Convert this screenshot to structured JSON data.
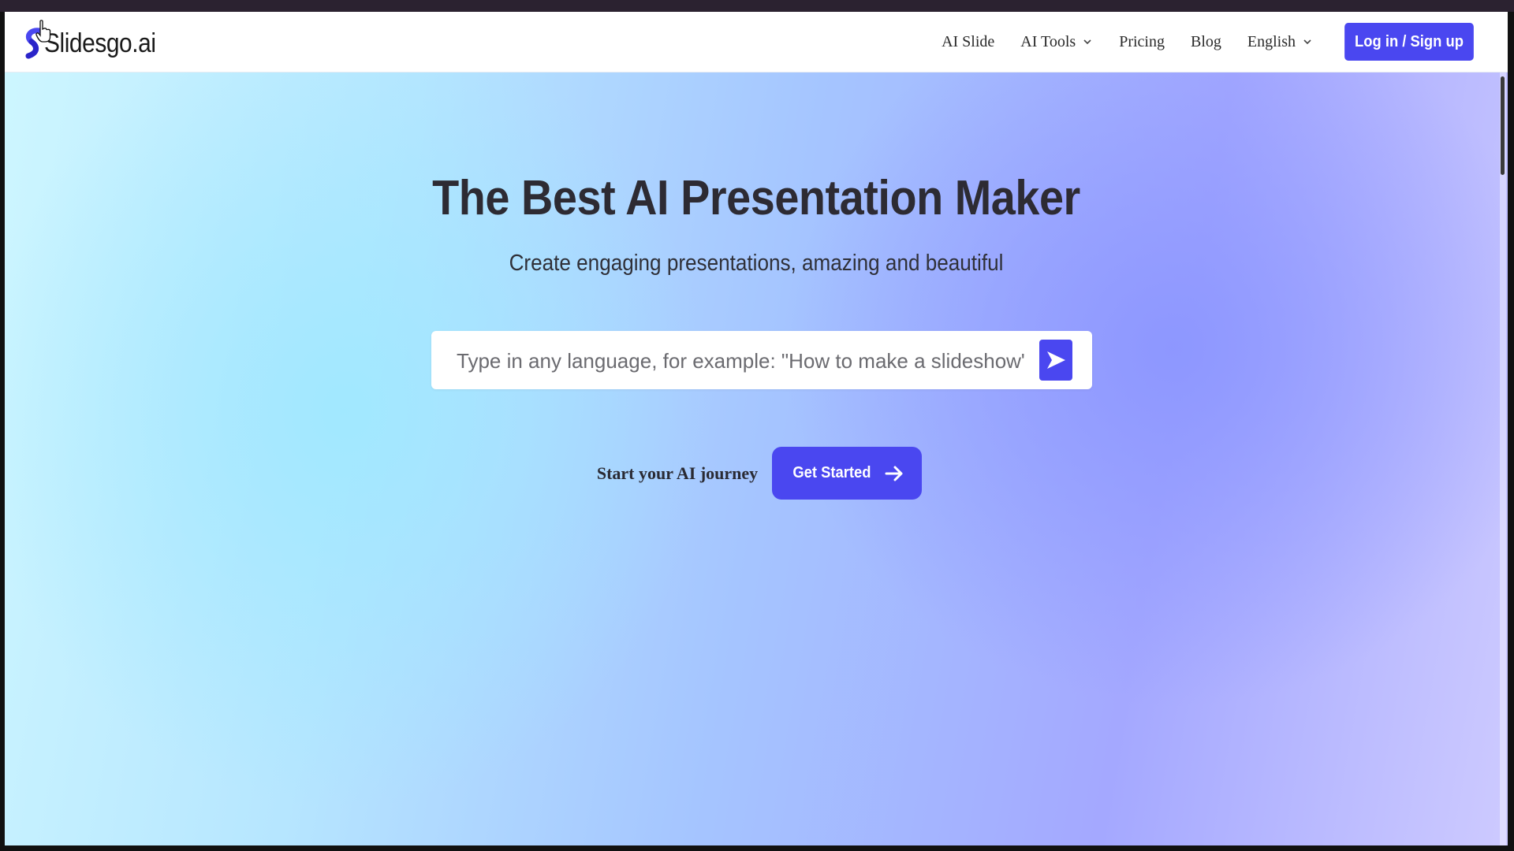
{
  "header": {
    "brand": "Slidesgo.ai",
    "nav": [
      {
        "label": "AI Slide",
        "dropdown": false
      },
      {
        "label": "AI Tools",
        "dropdown": true
      },
      {
        "label": "Pricing",
        "dropdown": false
      },
      {
        "label": "Blog",
        "dropdown": false
      },
      {
        "label": "English",
        "dropdown": true
      }
    ],
    "login_label": "Log in / Sign up"
  },
  "hero": {
    "title": "The Best AI Presentation Maker",
    "subtitle": "Create engaging presentations, amazing and beautiful",
    "search": {
      "placeholder": "Type in any language, for example: \"How to make a slideshow\"",
      "value": ""
    },
    "cta_text": "Start your AI journey",
    "cta_button": "Get Started"
  },
  "colors": {
    "accent": "#4a47f0",
    "title_text": "#2d2b33",
    "hero_gradient_left": "#cdf6ff",
    "hero_gradient_right": "#cdcaff"
  },
  "icons": {
    "send": "send-arrow-icon",
    "cta": "arrow-right-icon",
    "dropdown": "chevron-down-icon",
    "logo": "slidesgo-logo-icon",
    "cursor": "hand-pointer-cursor"
  }
}
